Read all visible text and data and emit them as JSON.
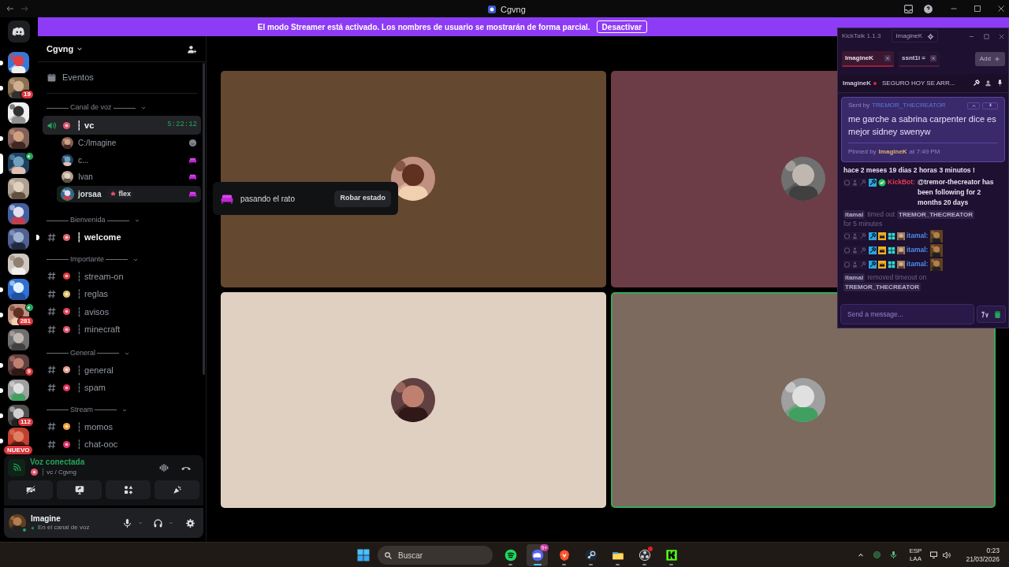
{
  "titlebar": {
    "title": "Cgvng"
  },
  "servers": [
    {
      "unread": true,
      "selected": false,
      "voice_active": false
    },
    {
      "unread": true,
      "selected": false,
      "voice_active": false,
      "badge": "19"
    },
    {
      "unread": false,
      "selected": false,
      "voice_active": false
    },
    {
      "unread": true,
      "selected": false,
      "voice_active": false
    },
    {
      "unread": false,
      "selected": true,
      "voice_active": true
    },
    {
      "unread": false,
      "selected": false,
      "voice_active": false
    },
    {
      "unread": false,
      "selected": false,
      "voice_active": false
    },
    {
      "unread": false,
      "selected": false,
      "voice_active": false
    },
    {
      "unread": false,
      "selected": false,
      "voice_active": false
    },
    {
      "unread": true,
      "selected": false,
      "voice_active": false
    },
    {
      "unread": true,
      "selected": false,
      "voice_active": true,
      "badge": "281"
    },
    {
      "unread": false,
      "selected": false,
      "voice_active": false
    },
    {
      "unread": true,
      "selected": false,
      "voice_active": false,
      "badge": "9"
    },
    {
      "unread": true,
      "selected": false,
      "voice_active": false
    },
    {
      "unread": true,
      "selected": false,
      "voice_active": false,
      "badge": "112"
    },
    {
      "unread": true,
      "selected": false,
      "voice_active": false,
      "badge": "NUEVO"
    }
  ],
  "banner": {
    "text": "El modo Streamer está activado. Los nombres de usuario se mostrarán de forma parcial.",
    "button": "Desactivar"
  },
  "sidebar": {
    "server_name": "Cgvng",
    "events": "Eventos",
    "categories": [
      {
        "label": "Canal de voz",
        "channels": [
          {
            "kind": "voice",
            "name": "┆ vc",
            "timer": "5:22:12",
            "selected": true,
            "color": "#e05570",
            "members": [
              {
                "name": "C:/Imagine",
                "kind": "status",
                "highlighted": false
              },
              {
                "name": "c...",
                "kind": "activity",
                "highlighted": false
              },
              {
                "name": "Ivan",
                "kind": "activity",
                "highlighted": false
              },
              {
                "name": "jorsaa",
                "tag": "flex",
                "kind": "activity",
                "highlighted": true
              }
            ]
          }
        ]
      },
      {
        "label": "Bienvenida",
        "channels": [
          {
            "kind": "text",
            "name": "┆ welcome",
            "selected": false,
            "unread": true,
            "color": "#e0606a"
          }
        ]
      },
      {
        "label": "Importante",
        "channels": [
          {
            "kind": "text",
            "name": "┆ stream-on",
            "selected": false,
            "unread": false,
            "color": "#e03a3a"
          },
          {
            "kind": "text",
            "name": "┆ reglas",
            "selected": false,
            "unread": false,
            "color": "#e0c070"
          },
          {
            "kind": "text",
            "name": "┆ avisos",
            "selected": false,
            "unread": false,
            "color": "#e0405a"
          },
          {
            "kind": "text",
            "name": "┆ minecraft",
            "selected": false,
            "unread": false,
            "color": "#e05570"
          }
        ]
      },
      {
        "label": "General",
        "channels": [
          {
            "kind": "text",
            "name": "┆ general",
            "selected": false,
            "unread": false,
            "color": "#e8a090"
          },
          {
            "kind": "text",
            "name": "┆ spam",
            "selected": false,
            "unread": false,
            "color": "#e0305a"
          }
        ]
      },
      {
        "label": "Stream",
        "channels": [
          {
            "kind": "text",
            "name": "┆ momos",
            "selected": false,
            "unread": false,
            "color": "#f0a040"
          },
          {
            "kind": "text",
            "name": "┆ chat-ooc",
            "selected": false,
            "unread": false,
            "color": "#e0306a"
          }
        ]
      }
    ]
  },
  "voice_panel": {
    "status": "Voz conectada",
    "channel": "┆ vc / Cgvng"
  },
  "user_panel": {
    "name": "Imagine",
    "status": "En el canal de voz"
  },
  "popup": {
    "status": "pasando el rato",
    "button": "Robar estado"
  },
  "tiles": [
    {
      "color": "#654830",
      "speaking": false
    },
    {
      "color": "#6c3d47",
      "speaking": false
    },
    {
      "color": "#dfd0c1",
      "speaking": false
    },
    {
      "color": "#7b6a5d",
      "speaking": true
    }
  ],
  "kicktalk": {
    "title": "KickTalk 1.1.3",
    "account": "ImagineK",
    "tabs": [
      {
        "label": "ImagineK",
        "selected": true
      },
      {
        "label": "ssnt1i =",
        "selected": false
      }
    ],
    "add_button": "Add",
    "channel": {
      "name": "ImagineK",
      "live": true,
      "stream_title": "SEGURO HOY SE ARR..."
    },
    "pinned": {
      "sent_by_label": "Sent by",
      "sender": "TREMOR_THECREATOR",
      "message": "me garche a sabrina carpenter dice es mejor sidney swenyw",
      "pinned_by_label": "Pinned by",
      "pinned_by": "ImagineK",
      "time": "at 7:49 PM"
    },
    "messages": [
      {
        "kind": "text",
        "text": "hace 2 meses 19 dias 2 horas 3 minutos !"
      },
      {
        "kind": "chat",
        "user": "KickBot:",
        "color": "#e53950",
        "badges": [
          {
            "kind": "mod"
          },
          {
            "kind": "verified"
          }
        ],
        "text": "@tremor-thecreator has been following for 2 months 20 days"
      },
      {
        "kind": "event",
        "actor": "itamal",
        "action": "timed out",
        "target": "TREMOR_THECREATOR",
        "suffix": "for 5 minutes"
      },
      {
        "kind": "chat",
        "user": "itamal:",
        "color": "#4a8ff0",
        "badges": [
          {
            "kind": "mod"
          },
          {
            "kind": "crown"
          },
          {
            "kind": "og"
          },
          {
            "kind": "avatar"
          }
        ],
        "emote": true
      },
      {
        "kind": "chat",
        "user": "itamal:",
        "color": "#4a8ff0",
        "badges": [
          {
            "kind": "mod"
          },
          {
            "kind": "crown"
          },
          {
            "kind": "og"
          },
          {
            "kind": "avatar"
          }
        ],
        "emote": true
      },
      {
        "kind": "chat",
        "user": "itamal:",
        "color": "#4a8ff0",
        "badges": [
          {
            "kind": "mod"
          },
          {
            "kind": "crown"
          },
          {
            "kind": "og"
          },
          {
            "kind": "avatar"
          }
        ],
        "emote": true
      },
      {
        "kind": "event",
        "actor": "itamal",
        "action": "removed timeout on",
        "target": "TREMOR_THECREATOR"
      }
    ],
    "input": {
      "placeholder": "Send a message..."
    }
  },
  "taskbar": {
    "search_placeholder": "Buscar",
    "apps": [
      {
        "kind": "spotify",
        "active": false,
        "alert": false
      },
      {
        "kind": "discord",
        "active": true,
        "alert": false,
        "badge": "9+"
      },
      {
        "kind": "brave",
        "active": false,
        "alert": false
      },
      {
        "kind": "steam",
        "active": false,
        "alert": false
      },
      {
        "kind": "folder",
        "active": false,
        "alert": false
      },
      {
        "kind": "obs",
        "active": false,
        "alert": true
      },
      {
        "kind": "kick",
        "active": false,
        "alert": false
      }
    ],
    "lang": "ESP",
    "layout": "LAA",
    "time": "0:23",
    "date": "21/03/2026"
  }
}
